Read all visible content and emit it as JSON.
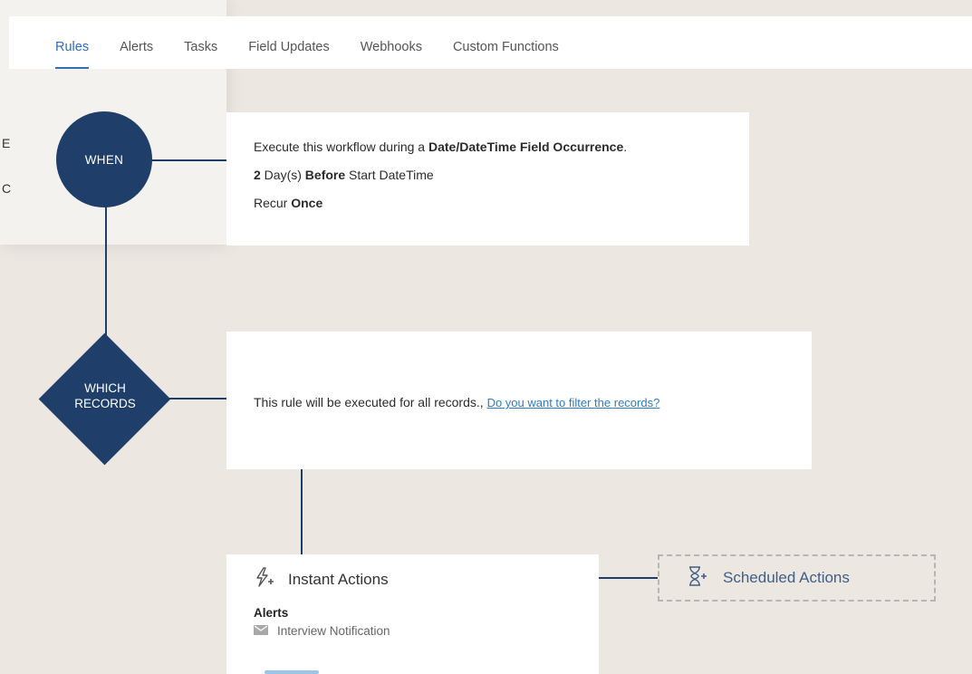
{
  "tabs": [
    {
      "label": "Rules",
      "active": true
    },
    {
      "label": "Alerts",
      "active": false
    },
    {
      "label": "Tasks",
      "active": false
    },
    {
      "label": "Field Updates",
      "active": false
    },
    {
      "label": "Webhooks",
      "active": false
    },
    {
      "label": "Custom Functions",
      "active": false
    }
  ],
  "background_fragments": [
    "E",
    "C"
  ],
  "when": {
    "label": "WHEN",
    "line1_prefix": "Execute this workflow during a ",
    "line1_bold": "Date/DateTime Field Occurrence",
    "line1_suffix": ".",
    "line2_value": "2",
    "line2_unit": " Day(s) ",
    "line2_bold": "Before",
    "line2_field": " Start DateTime",
    "line3_prefix": "Recur ",
    "line3_bold": "Once"
  },
  "which": {
    "label_line1": "WHICH",
    "label_line2": "RECORDS",
    "text": "This rule will be executed for all records.,",
    "filter_link": "Do you want to filter the records?"
  },
  "instant_actions": {
    "title": "Instant Actions",
    "group_label": "Alerts",
    "item": "Interview Notification"
  },
  "scheduled_actions": {
    "title": "Scheduled Actions"
  },
  "colors": {
    "accent": "#2f6fb5",
    "shape": "#1f3f6a",
    "background": "#ece7e1",
    "link": "#2f7bc0"
  }
}
